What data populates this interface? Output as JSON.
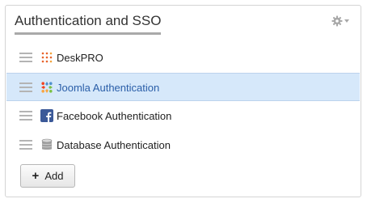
{
  "panel": {
    "title": "Authentication and SSO",
    "menu_icon": "gear-dropdown-icon"
  },
  "items": [
    {
      "label": "DeskPRO",
      "icon": "deskpro-icon",
      "selected": false
    },
    {
      "label": "Joomla Authentication",
      "icon": "joomla-icon",
      "selected": true
    },
    {
      "label": "Facebook Authentication",
      "icon": "facebook-icon",
      "selected": false
    },
    {
      "label": "Database Authentication",
      "icon": "database-icon",
      "selected": false
    }
  ],
  "add_button": {
    "icon": "plus-icon",
    "label": "Add"
  },
  "colors": {
    "selected_row_bg": "#d6e8fa",
    "selected_text": "#2a5ea8",
    "deskpro_orange": "#e8632b",
    "joomla_red": "#e44d26",
    "facebook_blue": "#3b5998"
  }
}
